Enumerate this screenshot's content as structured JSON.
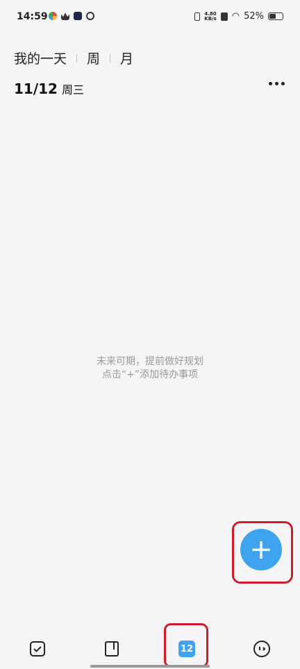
{
  "status_bar": {
    "time": "14:59",
    "network_speed_top": "4.80",
    "network_speed_bottom": "KB/s",
    "battery_percent": "52%",
    "battery_level": 0.52
  },
  "tabs": [
    {
      "label": "我的一天",
      "active": true
    },
    {
      "label": "周",
      "active": false
    },
    {
      "label": "月",
      "active": false
    }
  ],
  "date_header": {
    "date": "11/12",
    "weekday": "周三"
  },
  "empty_state": {
    "line1": "未来可期，提前做好规划",
    "line2": "点击“+”添加待办事项"
  },
  "fab": {
    "label": "+"
  },
  "bottom_nav": {
    "calendar_day": "12"
  },
  "colors": {
    "accent": "#3fa3f0",
    "highlight": "#d01c2a",
    "background": "#f5f5f7"
  }
}
